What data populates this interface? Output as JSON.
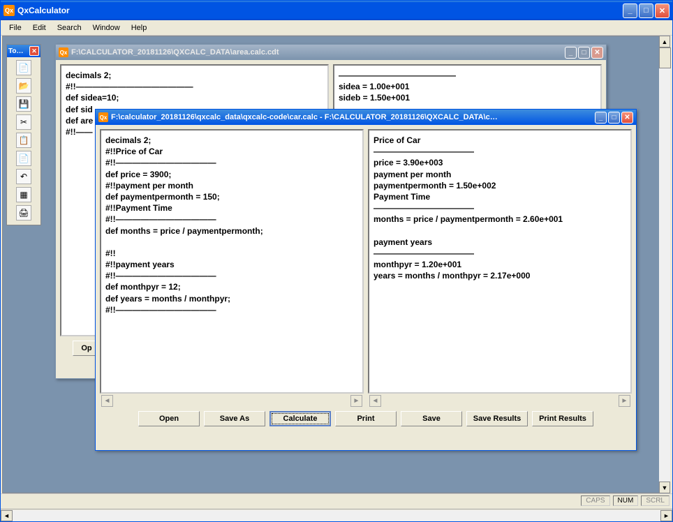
{
  "app": {
    "title": "QxCalculator"
  },
  "menu": {
    "file": "File",
    "edit": "Edit",
    "search": "Search",
    "window": "Window",
    "help": "Help"
  },
  "toolpalette": {
    "title": "To…"
  },
  "child1": {
    "title": "F:\\CALCULATOR_20181126\\QXCALC_DATA\\area.calc.cdt",
    "left_text": "decimals 2;\n#!!——————————————\ndef sidea=10;\ndef sid\ndef are\n#!!——",
    "right_text": "——————————————\nsidea = 1.00e+001\nsideb = 1.50e+001",
    "buttons": {
      "open": "Op"
    }
  },
  "child2": {
    "title": "F:\\calculator_20181126\\qxcalc_data\\qxcalc-code\\car.calc - F:\\CALCULATOR_20181126\\QXCALC_DATA\\c…",
    "left_text": "decimals 2;\n#!!Price of Car\n#!!————————————\ndef price = 3900;\n#!!payment per month\ndef paymentpermonth = 150;\n#!!Payment Time\n#!!————————————\ndef months = price / paymentpermonth;\n\n#!!\n#!!payment years\n#!!————————————\ndef monthpyr = 12;\ndef years = months / monthpyr;\n#!!————————————",
    "right_text": "Price of Car\n————————————\nprice = 3.90e+003\npayment per month\npaymentpermonth = 1.50e+002\nPayment Time\n————————————\nmonths = price / paymentpermonth = 2.60e+001\n\npayment years\n————————————\nmonthpyr = 1.20e+001\nyears = months / monthpyr = 2.17e+000",
    "buttons": {
      "open": "Open",
      "saveas": "Save As",
      "calculate": "Calculate",
      "print": "Print",
      "save": "Save",
      "saveresults": "Save Results",
      "printresults": "Print Results"
    }
  },
  "status": {
    "caps": "CAPS",
    "num": "NUM",
    "scrl": "SCRL"
  }
}
